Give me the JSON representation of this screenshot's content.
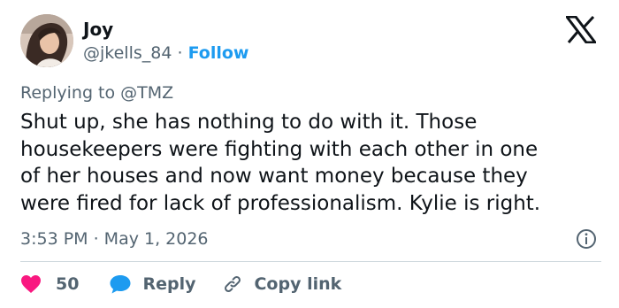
{
  "author": {
    "name": "Joy",
    "handle": "@jkells_84",
    "separator": "·",
    "follow_label": "Follow",
    "avatar_icon": "profile-photo"
  },
  "brand": {
    "logo_icon": "x-logo"
  },
  "reply_context": {
    "prefix": "Replying to",
    "mention": "@TMZ"
  },
  "post": {
    "lines": [
      "Shut up, she has nothing to do with it. Those",
      "housekeepers were fighting with each other in one",
      "of her houses and now want money because they",
      "were fired for lack of professionalism. Kylie is right."
    ]
  },
  "meta": {
    "timestamp": "3:53 PM · May 1, 2026",
    "info_icon": "info-icon"
  },
  "actions": {
    "like_count": "50",
    "like_icon": "heart-icon",
    "reply_label": "Reply",
    "reply_icon": "speech-bubble-icon",
    "copy_label": "Copy link",
    "copy_icon": "link-icon"
  },
  "colors": {
    "text": "#0f1419",
    "secondary": "#536471",
    "accent": "#1d9bf0",
    "heart": "#f91880",
    "divider": "#cfd9de"
  }
}
